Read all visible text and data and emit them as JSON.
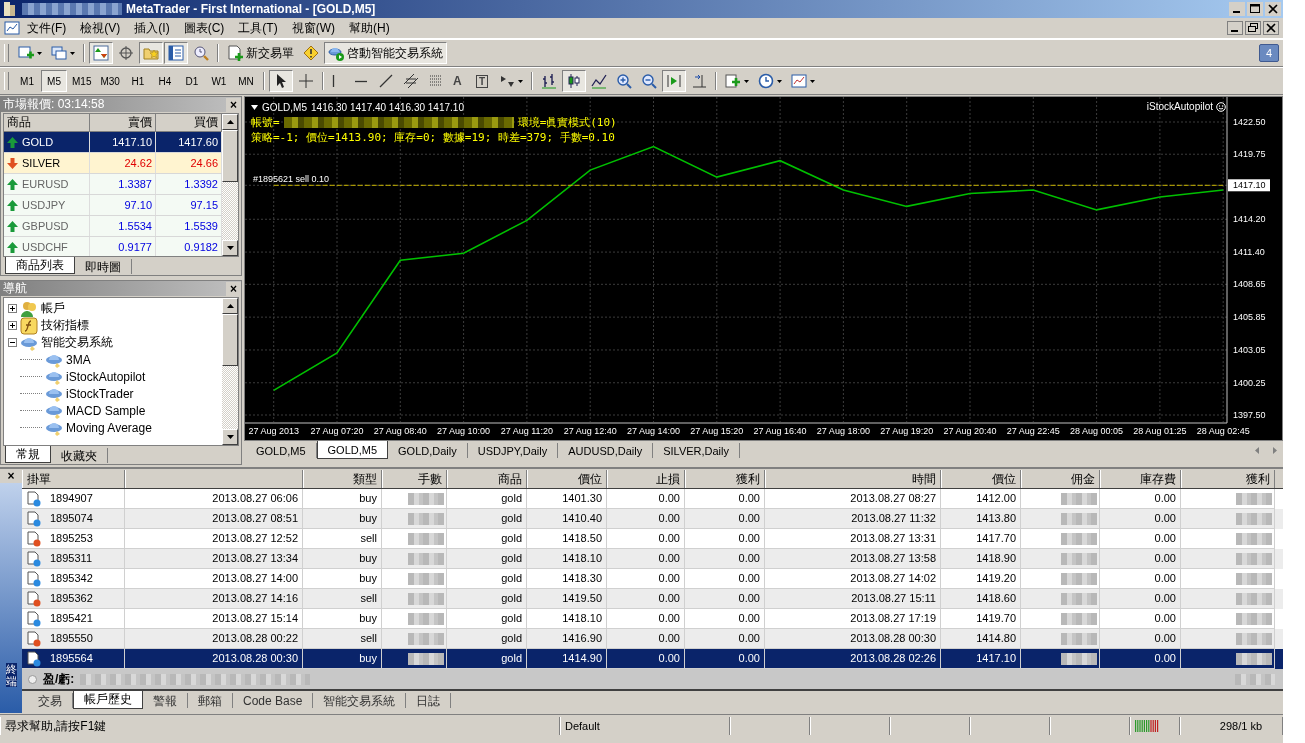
{
  "window": {
    "title": "MetaTrader - First International - [GOLD,M5]"
  },
  "menu": [
    "文件(F)",
    "檢視(V)",
    "插入(I)",
    "圖表(C)",
    "工具(T)",
    "視窗(W)",
    "幫助(H)"
  ],
  "notification_badge": "4",
  "toolbar": [
    {
      "kind": "new-chart",
      "selected": false
    },
    {
      "kind": "profiles",
      "selected": false
    },
    {
      "kind": "market-watch",
      "selected": true
    },
    {
      "kind": "data-window",
      "selected": false
    },
    {
      "kind": "navigator",
      "selected": true
    },
    {
      "kind": "terminal",
      "selected": true
    },
    {
      "kind": "tester",
      "selected": false
    },
    {
      "kind": "new-order",
      "label": "新交易單",
      "selected": false
    },
    {
      "kind": "editor",
      "selected": false
    },
    {
      "kind": "experts",
      "label": "啓動智能交易系統",
      "selected": true
    }
  ],
  "timeframes": [
    {
      "label": "M1",
      "selected": false
    },
    {
      "label": "M5",
      "selected": true
    },
    {
      "label": "M15",
      "selected": false
    },
    {
      "label": "M30",
      "selected": false
    },
    {
      "label": "H1",
      "selected": false
    },
    {
      "label": "H4",
      "selected": false
    },
    {
      "label": "D1",
      "selected": false
    },
    {
      "label": "W1",
      "selected": false
    },
    {
      "label": "MN",
      "selected": false
    }
  ],
  "draw_tools": [
    {
      "kind": "cursor",
      "selected": true
    },
    {
      "kind": "crosshair",
      "selected": false
    },
    {
      "kind": "vline",
      "selected": false
    },
    {
      "kind": "hline",
      "selected": false
    },
    {
      "kind": "trendline",
      "selected": false
    },
    {
      "kind": "channel",
      "selected": false
    },
    {
      "kind": "fibo",
      "selected": false
    },
    {
      "kind": "text",
      "label": "A",
      "selected": false
    },
    {
      "kind": "label",
      "label": "T",
      "selected": false
    },
    {
      "kind": "arrows",
      "selected": false
    },
    {
      "kind": "bar-chart",
      "selected": false
    },
    {
      "kind": "candle-chart",
      "selected": true
    },
    {
      "kind": "line-chart",
      "selected": false
    },
    {
      "kind": "zoom-in",
      "selected": false
    },
    {
      "kind": "zoom-out",
      "selected": false
    },
    {
      "kind": "autoscroll",
      "selected": true
    },
    {
      "kind": "chart-shift",
      "selected": false
    },
    {
      "kind": "indicators",
      "selected": false
    },
    {
      "kind": "periods",
      "selected": false
    },
    {
      "kind": "templates",
      "selected": false
    }
  ],
  "market_watch": {
    "title": "市場報價: 03:14:58",
    "close": "×",
    "columns": [
      "商品",
      "賣價",
      "買價"
    ],
    "rows": [
      {
        "symbol": "GOLD",
        "bid": "1417.10",
        "ask": "1417.60",
        "kind": "up",
        "selected": true
      },
      {
        "symbol": "SILVER",
        "bid": "24.62",
        "ask": "24.66",
        "kind": "down",
        "selected": false
      },
      {
        "symbol": "EURUSD",
        "bid": "1.3387",
        "ask": "1.3392",
        "kind": "up",
        "selected": false
      },
      {
        "symbol": "USDJPY",
        "bid": "97.10",
        "ask": "97.15",
        "kind": "up",
        "selected": false
      },
      {
        "symbol": "GBPUSD",
        "bid": "1.5534",
        "ask": "1.5539",
        "kind": "up",
        "selected": false
      },
      {
        "symbol": "USDCHF",
        "bid": "0.9177",
        "ask": "0.9182",
        "kind": "up",
        "selected": false
      }
    ],
    "tabs": [
      {
        "label": "商品列表",
        "selected": true
      },
      {
        "label": "即時圖",
        "selected": false
      }
    ]
  },
  "navigator": {
    "title": "導航",
    "close": "×",
    "tree": [
      {
        "label": "帳戶",
        "kind": "account",
        "expanded": false
      },
      {
        "label": "技術指標",
        "kind": "indicator",
        "expanded": false
      },
      {
        "label": "智能交易系統",
        "kind": "expert",
        "expanded": true,
        "children": [
          {
            "label": "3MA",
            "kind": "expert"
          },
          {
            "label": "iStockAutopilot",
            "kind": "expert"
          },
          {
            "label": "iStockTrader",
            "kind": "expert"
          },
          {
            "label": "MACD Sample",
            "kind": "expert"
          },
          {
            "label": "Moving Average",
            "kind": "expert"
          }
        ]
      }
    ],
    "tabs": [
      {
        "label": "常規",
        "selected": true
      },
      {
        "label": "收藏夾",
        "selected": false
      }
    ]
  },
  "chart": {
    "symbol": "GOLD,M5",
    "ohlc": "1416.30 1417.40 1416.30 1417.10",
    "account_label": "帳號=",
    "environment": "環境=眞實模式(10)",
    "status": "策略=-1; 價位=1413.90; 庫存=0; 數據=19; 時差=379; 手數=0.10",
    "expert_name": "iStockAutopilot",
    "chart_data": {
      "type": "line",
      "grid": true,
      "categories": [
        "27 Aug 2013",
        "27 Aug 07:20",
        "27 Aug 08:40",
        "27 Aug 10:00",
        "27 Aug 11:20",
        "27 Aug 12:40",
        "27 Aug 14:00",
        "27 Aug 15:20",
        "27 Aug 16:40",
        "27 Aug 18:00",
        "27 Aug 19:20",
        "27 Aug 20:40",
        "27 Aug 22:45",
        "28 Aug 00:05",
        "28 Aug 01:25",
        "28 Aug 02:45"
      ],
      "series": [
        {
          "color": "#00c000",
          "line_style": "solid",
          "values": [
            1399.6,
            1402.8,
            1410.7,
            1411.3,
            1414.1,
            1418.4,
            1420.4,
            1417.8,
            1419.2,
            1416.7,
            1415.3,
            1416.4,
            1416.7,
            1415.0,
            1416.1,
            1416.7
          ]
        },
        {
          "name": "#1895621 sell 0.10",
          "color": "#c8b400",
          "line_style": "dashed",
          "values": [
            1417.1,
            1417.1,
            1417.1,
            1417.1,
            1417.1,
            1417.1,
            1417.1,
            1417.1,
            1417.1,
            1417.1,
            1417.1,
            1417.1,
            1417.1,
            1417.1,
            1417.1,
            1417.1
          ]
        }
      ],
      "ylim": [
        1397.5,
        1422.5
      ],
      "yticks": [
        {
          "value": 1397.5,
          "label": "1397.50"
        },
        {
          "value": 1400.25,
          "label": "1400.25"
        },
        {
          "value": 1403.05,
          "label": "1403.05"
        },
        {
          "value": 1405.85,
          "label": "1405.85"
        },
        {
          "value": 1408.65,
          "label": "1408.65"
        },
        {
          "value": 1411.4,
          "label": "1411.40"
        },
        {
          "value": 1414.2,
          "label": "1414.20"
        },
        {
          "value": 1417.1,
          "label": "1417.10"
        },
        {
          "value": 1419.75,
          "label": "1419.75"
        },
        {
          "value": 1422.5,
          "label": "1422.50"
        }
      ]
    }
  },
  "chart_tabs": [
    {
      "label": "GOLD,M5",
      "selected": false
    },
    {
      "label": "GOLD,M5",
      "selected": true
    },
    {
      "label": "GOLD,Daily",
      "selected": false
    },
    {
      "label": "USDJPY,Daily",
      "selected": false
    },
    {
      "label": "AUDUSD,Daily",
      "selected": false
    },
    {
      "label": "SILVER,Daily",
      "selected": false
    }
  ],
  "terminal": {
    "close": "×",
    "side_label": "終端",
    "columns": [
      {
        "label": "掛單",
        "kind": "text"
      },
      {
        "kind": "text"
      },
      {
        "label": "類型",
        "kind": "text"
      },
      {
        "label": "手數",
        "kind": "redacted"
      },
      {
        "label": "商品",
        "kind": "text"
      },
      {
        "label": "價位",
        "kind": "text"
      },
      {
        "label": "止損",
        "kind": "text"
      },
      {
        "label": "獲利",
        "kind": "text"
      },
      {
        "label": "時間",
        "kind": "text"
      },
      {
        "label": "價位",
        "kind": "text"
      },
      {
        "label": "佣金",
        "kind": "redacted"
      },
      {
        "label": "庫存費",
        "kind": "text"
      },
      {
        "label": "獲利",
        "kind": "redacted"
      }
    ],
    "rows": [
      {
        "kind": "buy",
        "selected": false,
        "cells": [
          "1894907",
          "2013.08.27 06:06",
          "buy",
          "",
          "gold",
          "1401.30",
          "0.00",
          "0.00",
          "2013.08.27 08:27",
          "1412.00",
          "",
          "0.00",
          ""
        ]
      },
      {
        "kind": "buy",
        "selected": false,
        "cells": [
          "1895074",
          "2013.08.27 08:51",
          "buy",
          "",
          "gold",
          "1410.40",
          "0.00",
          "0.00",
          "2013.08.27 11:32",
          "1413.80",
          "",
          "0.00",
          ""
        ]
      },
      {
        "kind": "sell",
        "selected": false,
        "cells": [
          "1895253",
          "2013.08.27 12:52",
          "sell",
          "",
          "gold",
          "1418.50",
          "0.00",
          "0.00",
          "2013.08.27 13:31",
          "1417.70",
          "",
          "0.00",
          ""
        ]
      },
      {
        "kind": "buy",
        "selected": false,
        "cells": [
          "1895311",
          "2013.08.27 13:34",
          "buy",
          "",
          "gold",
          "1418.10",
          "0.00",
          "0.00",
          "2013.08.27 13:58",
          "1418.90",
          "",
          "0.00",
          ""
        ]
      },
      {
        "kind": "buy",
        "selected": false,
        "cells": [
          "1895342",
          "2013.08.27 14:00",
          "buy",
          "",
          "gold",
          "1418.30",
          "0.00",
          "0.00",
          "2013.08.27 14:02",
          "1419.20",
          "",
          "0.00",
          ""
        ]
      },
      {
        "kind": "sell",
        "selected": false,
        "cells": [
          "1895362",
          "2013.08.27 14:16",
          "sell",
          "",
          "gold",
          "1419.50",
          "0.00",
          "0.00",
          "2013.08.27 15:11",
          "1418.60",
          "",
          "0.00",
          ""
        ]
      },
      {
        "kind": "buy",
        "selected": false,
        "cells": [
          "1895421",
          "2013.08.27 15:14",
          "buy",
          "",
          "gold",
          "1418.10",
          "0.00",
          "0.00",
          "2013.08.27 17:19",
          "1419.70",
          "",
          "0.00",
          ""
        ]
      },
      {
        "kind": "sell",
        "selected": false,
        "cells": [
          "1895550",
          "2013.08.28 00:22",
          "sell",
          "",
          "gold",
          "1416.90",
          "0.00",
          "0.00",
          "2013.08.28 00:30",
          "1414.80",
          "",
          "0.00",
          ""
        ]
      },
      {
        "kind": "buy",
        "selected": true,
        "cells": [
          "1895564",
          "2013.08.28 00:30",
          "buy",
          "",
          "gold",
          "1414.90",
          "0.00",
          "0.00",
          "2013.08.28 02:26",
          "1417.10",
          "",
          "0.00",
          ""
        ]
      }
    ],
    "summary_label": "盈/虧:",
    "tabs": [
      {
        "label": "交易",
        "selected": false
      },
      {
        "label": "帳戶歷史",
        "selected": true
      },
      {
        "label": "警報",
        "selected": false
      },
      {
        "label": "郵箱",
        "selected": false
      },
      {
        "label": "Code Base",
        "selected": false
      },
      {
        "label": "智能交易系統",
        "selected": false
      },
      {
        "label": "日誌",
        "selected": false
      }
    ]
  },
  "status_bar": {
    "help": "尋求幫助,請按F1鍵",
    "profile": "Default",
    "traffic": "298/1 kb"
  }
}
